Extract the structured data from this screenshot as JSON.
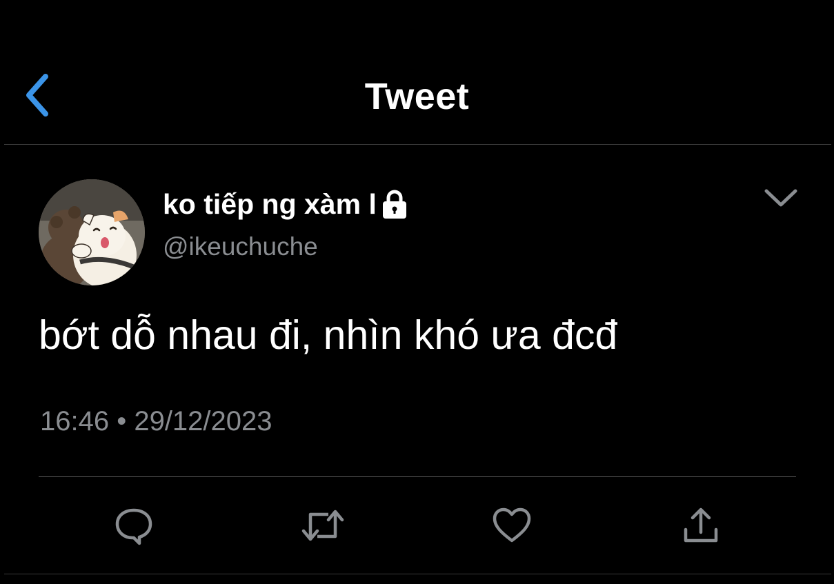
{
  "header": {
    "title": "Tweet",
    "back_icon": "chevron-left-icon",
    "accent_color": "#1d9bf0"
  },
  "tweet": {
    "author": {
      "display_name": "ko tiếp ng xàm l",
      "handle": "@ikeuchuche",
      "protected_icon": "lock-icon",
      "avatar": "avatar-illustration"
    },
    "more_icon": "chevron-down-icon",
    "text": "bớt dỗ nhau đi, nhìn khó ưa đcđ",
    "timestamp": "16:46 • 29/12/2023"
  },
  "actions": [
    {
      "name": "reply",
      "icon": "reply-icon"
    },
    {
      "name": "retweet",
      "icon": "retweet-icon"
    },
    {
      "name": "like",
      "icon": "heart-icon"
    },
    {
      "name": "share",
      "icon": "share-icon"
    }
  ],
  "colors": {
    "background": "#000000",
    "text": "#ffffff",
    "secondary_text": "#8a8d91",
    "divider": "#3a3a3a"
  }
}
